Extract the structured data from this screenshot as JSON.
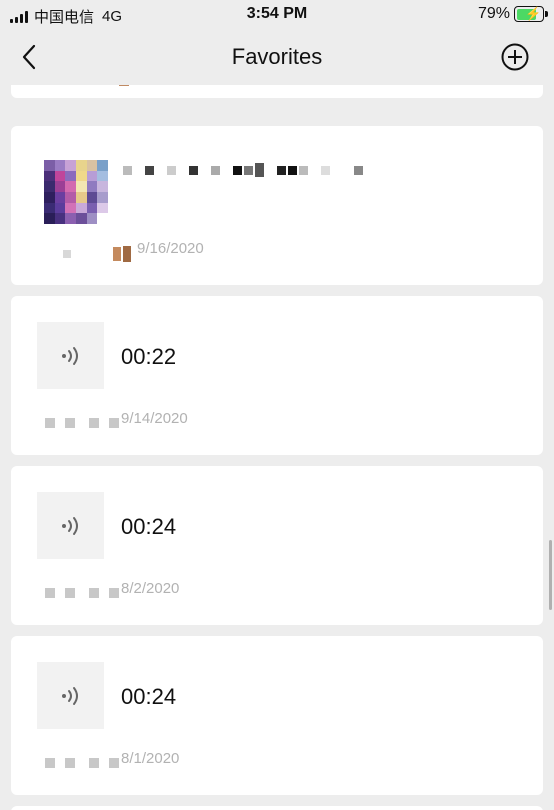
{
  "status_bar": {
    "carrier": "中国电信",
    "network": "4G",
    "time": "3:54 PM",
    "battery_percent": "79%",
    "battery_level": 0.79,
    "charging": true
  },
  "nav": {
    "title": "Favorites",
    "back_icon": "chevron-left-icon",
    "add_icon": "plus-circle-icon"
  },
  "items": [
    {
      "kind": "article",
      "date": "9/16/2020",
      "title_redacted": true
    },
    {
      "kind": "voice",
      "duration": "00:22",
      "date": "9/14/2020"
    },
    {
      "kind": "voice",
      "duration": "00:24",
      "date": "8/2/2020"
    },
    {
      "kind": "voice",
      "duration": "00:24",
      "date": "8/1/2020"
    }
  ]
}
